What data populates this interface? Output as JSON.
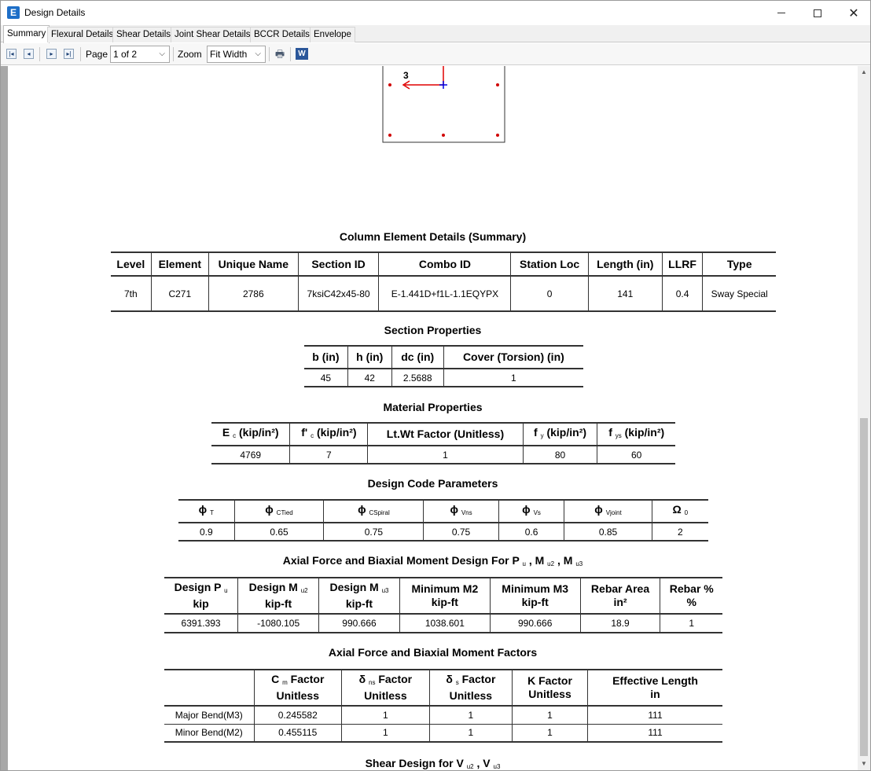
{
  "window": {
    "title": "Design Details",
    "app_icon_glyph": "E",
    "minimize_icon": "minimize-icon",
    "maximize_icon": "maximize-icon",
    "close_glyph": "✕"
  },
  "tabs": [
    {
      "label": "Summary",
      "active": true
    },
    {
      "label": "Flexural Details",
      "active": false
    },
    {
      "label": "Shear Details",
      "active": false
    },
    {
      "label": "Joint Shear Details",
      "active": false
    },
    {
      "label": "BCCR Details",
      "active": false
    },
    {
      "label": "Envelope",
      "active": false
    }
  ],
  "toolbar": {
    "page_label": "Page",
    "page_value": "1 of 2",
    "zoom_label": "Zoom",
    "zoom_value": "Fit Width",
    "first_glyph": "|◂",
    "prev_glyph": "◂",
    "next_glyph": "▸",
    "last_glyph": "▸|",
    "print_glyph": "🖶",
    "word_glyph": "W",
    "chevron": "⌵"
  },
  "section_sketch": {
    "axis_label": "3",
    "rebar_color": "#d00000",
    "axis_color_red": "#e00000",
    "axis_color_blue": "#0000e0"
  },
  "column_details": {
    "title": "Column Element Details  (Summary)",
    "headers": [
      "Level",
      "Element",
      "Unique Name",
      "Section ID",
      "Combo ID",
      "Station Loc",
      "Length (in)",
      "LLRF",
      "Type"
    ],
    "row": [
      "7th",
      "C271",
      "2786",
      "7ksiC42x45-80",
      "E-1.441D+f1L-1.1EQYPX",
      "0",
      "141",
      "0.4",
      "Sway Special"
    ]
  },
  "section_properties": {
    "title": "Section Properties",
    "headers": [
      "b (in)",
      "h (in)",
      "dc (in)",
      "Cover (Torsion) (in)"
    ],
    "row": [
      "45",
      "42",
      "2.5688",
      "1"
    ]
  },
  "material_properties": {
    "title": "Material Properties",
    "headers": [
      {
        "main": "E",
        "sub": "c",
        "tail": " (kip/in²)"
      },
      {
        "main": "f' ",
        "sub": "c",
        "tail": " (kip/in²)"
      },
      {
        "main": "Lt.Wt Factor (Unitless)",
        "sub": "",
        "tail": ""
      },
      {
        "main": "f ",
        "sub": "y",
        "tail": " (kip/in²)"
      },
      {
        "main": "f ",
        "sub": "ys",
        "tail": " (kip/in²)"
      }
    ],
    "row": [
      "4769",
      "7",
      "1",
      "80",
      "60"
    ]
  },
  "design_code_parameters": {
    "title": "Design Code Parameters",
    "headers": [
      {
        "main": "ϕ",
        "sub": "T"
      },
      {
        "main": "ϕ",
        "sub": "CTied"
      },
      {
        "main": "ϕ",
        "sub": "CSpiral"
      },
      {
        "main": "ϕ",
        "sub": "Vns"
      },
      {
        "main": "ϕ",
        "sub": "Vs"
      },
      {
        "main": "ϕ",
        "sub": "Vjoint"
      },
      {
        "main": "Ω",
        "sub": "0"
      }
    ],
    "row": [
      "0.9",
      "0.65",
      "0.75",
      "0.75",
      "0.6",
      "0.85",
      "2"
    ]
  },
  "axial_biaxial_design": {
    "title_a": "Axial Force and Biaxial Moment Design For P",
    "title_sub1": "u",
    "title_b": " , M",
    "title_sub2": "u2",
    "title_c": " , M",
    "title_sub3": "u3",
    "headers": [
      {
        "l1": "Design P",
        "sub": "u",
        "l2": "kip"
      },
      {
        "l1": "Design M",
        "sub": "u2",
        "l2": "kip-ft"
      },
      {
        "l1": "Design M",
        "sub": "u3",
        "l2": "kip-ft"
      },
      {
        "l1": "Minimum M2",
        "sub": "",
        "l2": "kip-ft"
      },
      {
        "l1": "Minimum M3",
        "sub": "",
        "l2": "kip-ft"
      },
      {
        "l1": "Rebar Area",
        "sub": "",
        "l2": "in²"
      },
      {
        "l1": "Rebar %",
        "sub": "",
        "l2": "%"
      }
    ],
    "row": [
      "6391.393",
      "-1080.105",
      "990.666",
      "1038.601",
      "990.666",
      "18.9",
      "1"
    ]
  },
  "axial_biaxial_factors": {
    "title": "Axial Force and Biaxial Moment Factors",
    "headers": [
      {
        "l1": "",
        "sub": "",
        "tail": "",
        "l2": ""
      },
      {
        "l1": "C",
        "sub": "m",
        "tail": " Factor",
        "l2": "Unitless"
      },
      {
        "l1": "δ",
        "sub": "ns",
        "tail": " Factor",
        "l2": "Unitless"
      },
      {
        "l1": "δ",
        "sub": "s",
        "tail": " Factor",
        "l2": "Unitless"
      },
      {
        "l1": "K Factor",
        "sub": "",
        "tail": "",
        "l2": "Unitless"
      },
      {
        "l1": "Effective Length",
        "sub": "",
        "tail": "",
        "l2": "in"
      }
    ],
    "rows": [
      [
        "Major Bend(M3)",
        "0.245582",
        "1",
        "1",
        "1",
        "111"
      ],
      [
        "Minor Bend(M2)",
        "0.455115",
        "1",
        "1",
        "1",
        "111"
      ]
    ]
  },
  "shear_design": {
    "title_a": "Shear Design for V",
    "title_sub1": "u2",
    "title_b": " , V",
    "title_sub2": "u3"
  }
}
